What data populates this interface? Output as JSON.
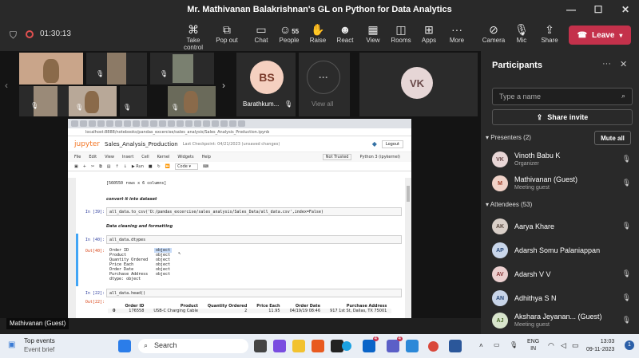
{
  "window": {
    "title": "Mr. Mathivanan Balakrishnan's GL on Python for Data Analytics",
    "minimize": "—",
    "maximize": "☐",
    "close": "✕"
  },
  "toolbar": {
    "timer": "01:30:13",
    "take_control": "Take control",
    "pop_out": "Pop out",
    "chat": "Chat",
    "people": "People",
    "people_count": "55",
    "raise": "Raise",
    "react": "React",
    "view": "View",
    "rooms": "Rooms",
    "apps": "Apps",
    "more": "More",
    "camera": "Camera",
    "mic": "Mic",
    "share": "Share",
    "leave": "Leave"
  },
  "stage": {
    "tile_bs_initials": "BS",
    "tile_bs_name": "Barathkum...",
    "view_all": "View all",
    "tile_vk_initials": "VK",
    "presenter_label": "Mathivanan (Guest)"
  },
  "notebook": {
    "url": "localhost:8888/notebooks/pandas_excercise/sales_analysis/Sales_Analysis_Production.ipynb",
    "logo": "jupyter",
    "title": "Sales_Analysis_Production",
    "checkpoint": "Last Checkpoint: 04/21/2023 (unsaved changes)",
    "logout": "Logout",
    "menu": [
      "File",
      "Edit",
      "View",
      "Insert",
      "Cell",
      "Kernel",
      "Widgets",
      "Help"
    ],
    "not_trusted": "Not Trusted",
    "kernel": "Python 3 (ipykernel)",
    "run": "Run",
    "cell_type": "Code",
    "rows_text": "[560550 rows x 6 columns]",
    "md1": "convert it into dataset",
    "in39_prompt": "In [39]:",
    "in39_code": "all_data.to_csv('D:/pandas_excercise/sales_analysis/Sales_Data/all_data.csv',index=False)",
    "md2": "Data cleaning and formatting",
    "in40_prompt": "In [40]:",
    "in40_code": "all_data.dtypes",
    "out40_prompt": "Out[40]:",
    "dtypes": [
      {
        "col": "Order ID",
        "type": "object"
      },
      {
        "col": "Product",
        "type": "object"
      },
      {
        "col": "Quantity Ordered",
        "type": "object"
      },
      {
        "col": "Price Each",
        "type": "object"
      },
      {
        "col": "Order Date",
        "type": "object"
      },
      {
        "col": "Purchase Address",
        "type": "object"
      }
    ],
    "dtype_footer": "dtype: object",
    "in22_prompt": "In [22]:",
    "in22_code": "all_data.head()",
    "out22_prompt": "Out[22]:",
    "df_headers": [
      "Order ID",
      "Product",
      "Quantity Ordered",
      "Price Each",
      "Order Date",
      "Purchase Address"
    ],
    "df_row": [
      "0",
      "176558",
      "USB-C Charging Cable",
      "2",
      "11.95",
      "04/19/19 08:46",
      "917 1st St, Dallas, TX 75001"
    ]
  },
  "panel": {
    "title": "Participants",
    "search_placeholder": "Type a name",
    "share_invite": "Share invite",
    "presenters_header": "Presenters (2)",
    "mute_all": "Mute all",
    "attendees_header": "Attendees (53)",
    "presenters": [
      {
        "initials": "VK",
        "name": "Vinoth Babu K",
        "role": "Organizer",
        "color": "#e8d6d6"
      },
      {
        "initials": "M",
        "name": "Mathivanan (Guest)",
        "role": "Meeting guest",
        "color": "#f0d2c8"
      }
    ],
    "attendees": [
      {
        "initials": "AK",
        "name": "Aarya Khare",
        "role": "",
        "color": "#d9cfc8"
      },
      {
        "initials": "AP",
        "name": "Adarsh Somu Palaniappan",
        "role": "",
        "color": "#c9d6ea"
      },
      {
        "initials": "AV",
        "name": "Adarsh V V",
        "role": "",
        "color": "#ecd0d0"
      },
      {
        "initials": "AN",
        "name": "Adhithya S N",
        "role": "",
        "color": "#c8d4e8"
      },
      {
        "initials": "AJ",
        "name": "Akshara Jeyanan... (Guest)",
        "role": "Meeting guest",
        "color": "#d8e4cc"
      }
    ]
  },
  "taskbar": {
    "news_title": "Top events",
    "news_sub": "Event brief",
    "search": "Search",
    "teams_badge": "4",
    "outlook_badge": "4",
    "lang1": "ENG",
    "lang2": "IN",
    "time": "13:03",
    "date": "09-11-2023",
    "notif": "1"
  }
}
